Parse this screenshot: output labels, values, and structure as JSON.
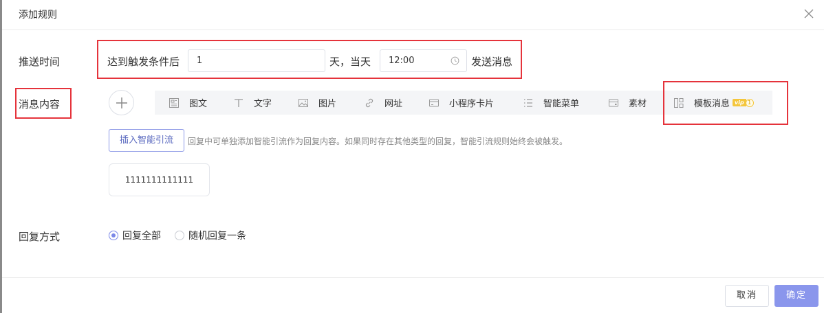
{
  "dialog": {
    "title": "添加规则",
    "close_icon": "close-icon"
  },
  "push_time": {
    "label": "推送时间",
    "prefix": "达到触发条件后",
    "days_value": "1",
    "day_unit": "天，当天",
    "time_value": "12:00",
    "time_icon": "clock-icon",
    "suffix": "发送消息"
  },
  "message_content": {
    "label": "消息内容",
    "add_icon": "plus-icon",
    "tools": [
      {
        "label": "图文",
        "icon": "article-icon"
      },
      {
        "label": "文字",
        "icon": "text-icon"
      },
      {
        "label": "图片",
        "icon": "image-icon"
      },
      {
        "label": "网址",
        "icon": "link-icon"
      },
      {
        "label": "小程序卡片",
        "icon": "miniprogram-card-icon"
      },
      {
        "label": "智能菜单",
        "icon": "menu-list-icon"
      },
      {
        "label": "素材",
        "icon": "material-icon"
      },
      {
        "label": "模板消息",
        "icon": "template-icon",
        "badge": "vip",
        "badge_num": "1"
      }
    ],
    "insert_button": "插入智能引流",
    "insert_hint": "回复中可单独添加智能引流作为回复内容。如果同时存在其他类型的回复，智能引流规则始终会被触发。",
    "message_card_text": "1111111111111"
  },
  "reply_mode": {
    "label": "回复方式",
    "options": [
      {
        "label": "回复全部",
        "checked": true
      },
      {
        "label": "随机回复一条",
        "checked": false
      }
    ]
  },
  "footer": {
    "cancel_label": "取消",
    "confirm_label": "确定"
  },
  "colors": {
    "highlight_red": "#e5333b",
    "primary": "#8a96ec",
    "vip_gold": "#f4c63c"
  }
}
